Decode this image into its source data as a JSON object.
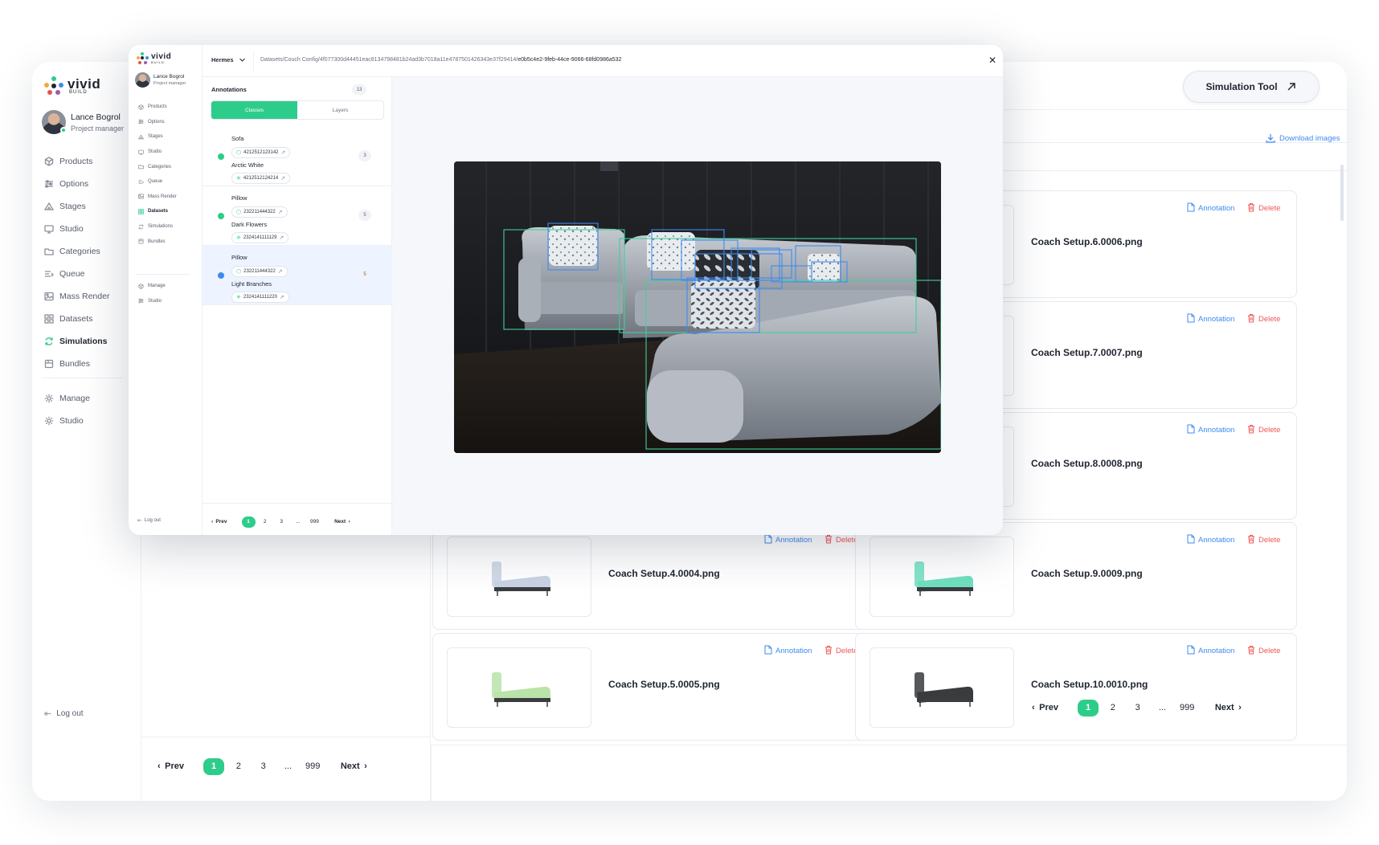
{
  "background_app": {
    "brand": {
      "name": "vivid",
      "sub": "BUILD"
    },
    "user": {
      "name": "Lance Bogrol",
      "role": "Project manager"
    },
    "nav": [
      {
        "label": "Products",
        "icon": "cube-icon"
      },
      {
        "label": "Options",
        "icon": "sliders-icon"
      },
      {
        "label": "Stages",
        "icon": "stage-icon"
      },
      {
        "label": "Studio",
        "icon": "monitor-icon"
      },
      {
        "label": "Categories",
        "icon": "folder-icon"
      },
      {
        "label": "Queue",
        "icon": "queue-icon"
      },
      {
        "label": "Mass Render",
        "icon": "image-icon"
      },
      {
        "label": "Datasets",
        "icon": "dataset-icon"
      },
      {
        "label": "Simulations",
        "icon": "refresh-icon"
      },
      {
        "label": "Bundles",
        "icon": "bundle-icon"
      }
    ],
    "active_nav": "Simulations",
    "nav2": [
      {
        "label": "Manage",
        "icon": "gear-icon"
      },
      {
        "label": "Studio",
        "icon": "gear-icon"
      }
    ],
    "logout": "Log out",
    "simulation_button": "Simulation Tool",
    "download_label": "Download images",
    "cards": [
      {
        "name": "Coach Setup.6.0006.png"
      },
      {
        "name": "Coach Setup.7.0007.png"
      },
      {
        "name": "Coach Setup.8.0008.png"
      },
      {
        "name": "Coach Setup.4.0004.png",
        "color": "#c9d3e3"
      },
      {
        "name": "Coach Setup.9.0009.png",
        "color": "#6fe0bf"
      },
      {
        "name": "Coach Setup.5.0005.png",
        "color": "#b9e3a8"
      },
      {
        "name": "Coach Setup.10.0010.png",
        "color": "#3a3b3d"
      }
    ],
    "annotation_label": "Annotation",
    "delete_label": "Delete",
    "pager": {
      "prev": "Prev",
      "next": "Next",
      "pages": [
        "1",
        "2",
        "3",
        "...",
        "999"
      ],
      "current": "1"
    }
  },
  "window": {
    "brand": {
      "name": "vivid",
      "sub": "BUILD"
    },
    "user": {
      "name": "Lance Bogrol",
      "role": "Project manager"
    },
    "nav": [
      "Products",
      "Options",
      "Stages",
      "Studio",
      "Categories",
      "Queue",
      "Mass Render",
      "Datasets",
      "Simulations",
      "Bundles"
    ],
    "active_nav": "Datasets",
    "nav2": [
      "Manage",
      "Studio"
    ],
    "logout": "Log out",
    "project": "Hermes",
    "path_prefix": "Datasets/Couch Config/4f077300d44451eac8134798481b24ad3b7018a11e4787501426343e37f29414/",
    "path_tail": "e0b5c4e2-9feb-44ce-9066-68fd0986a532",
    "annotations": {
      "title": "Annotations",
      "count": "13"
    },
    "tabs": [
      "Classes",
      "Layers"
    ],
    "items": [
      {
        "class": "Sofa",
        "class_id": "4212512123142",
        "variant": "Arctic White",
        "variant_id": "4212512124214",
        "count": "3",
        "color": "#2ecc8a",
        "selected": false
      },
      {
        "class": "Pillow",
        "class_id": "232211444322",
        "variant": "Dark Flowers",
        "variant_id": "2324141111129",
        "count": "5",
        "color": "#2ecc8a",
        "selected": false
      },
      {
        "class": "Pillow",
        "class_id": "232211444322",
        "variant": "Light Branches",
        "variant_id": "2324141111220",
        "count": "5",
        "color": "#3d8bf0",
        "selected": true
      }
    ],
    "pager": {
      "prev": "Prev",
      "next": "Next",
      "pages": [
        "1",
        "2",
        "3",
        "...",
        "999"
      ],
      "current": "1"
    },
    "box_colors": {
      "sofa": "#3fcf9a",
      "pillow": "#3d8bf0"
    }
  }
}
